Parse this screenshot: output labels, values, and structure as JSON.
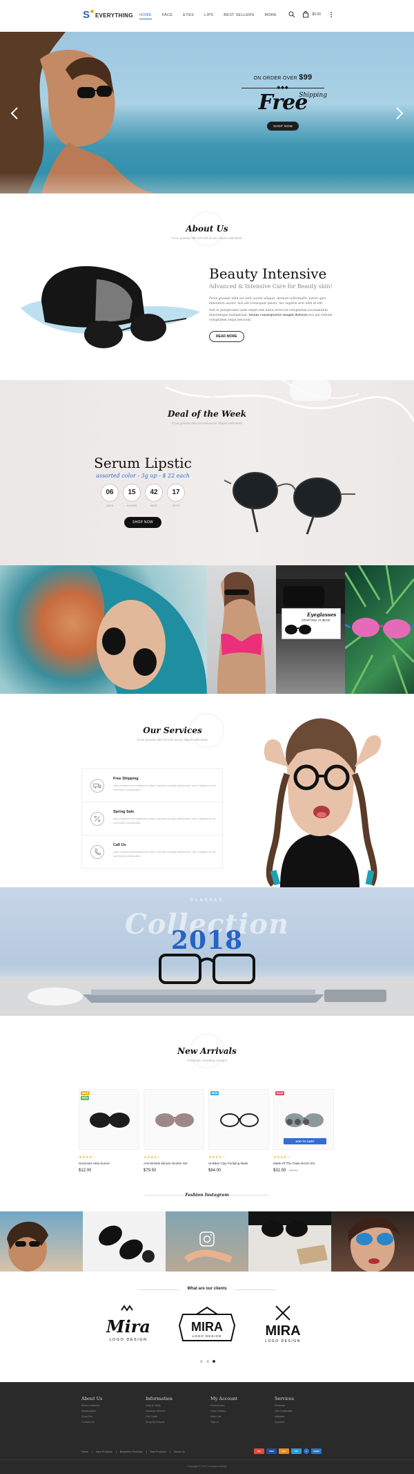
{
  "brand": {
    "logo_letter": "S",
    "name": "EVERYTHING",
    "colors": {
      "accent": "#2f6fd6",
      "dot": "#f2b31b"
    }
  },
  "nav": {
    "items": [
      "HOME",
      "FACE",
      "EYES",
      "LIPS",
      "BEST SELLERS",
      "MORE"
    ],
    "active": "HOME",
    "cart_total": "$0.00",
    "icons": [
      "search-icon",
      "cart-icon",
      "menu-dots-icon"
    ]
  },
  "hero": {
    "order_prefix": "ON ORDER OVER",
    "order_amount": "$99",
    "ornament": "♠♠♠",
    "free": "Free",
    "shipping": "Shipping",
    "button": "SHOP NOW"
  },
  "about": {
    "heading": "About Us",
    "subheading": "Proin gravida nibh vel velit auctor aliquet sollicitudin",
    "title": "Beauty Intensive",
    "tagline": "Advanced & Intensive Care for Beauty skin!",
    "p1": "Proin gravida nibh vel velit auctor aliquet. Aenean sollicitudin, lorem quis bibendum auctor, nisi elit consequat ipsum, nec sagittis sem nibh id elit.",
    "p2_a": "Sed ut perspiciatis unde omnis iste natus error sit voluptatem accusantium doloremque laudantium,",
    "p2_b": "totam consequatur magni dolores",
    "p2_c": "eos qui ratione voluptatem sequi nesciunt.",
    "button": "READ MORE"
  },
  "deal": {
    "heading": "Deal of the Week",
    "subheading": "Proin gravida nibh vel velit auctor aliquet sollicitudin",
    "title": "Serum Lipstic",
    "subtitle": "assorted color - 3g up - $ 22 each",
    "countdown": [
      {
        "value": "06",
        "label": "DAYS"
      },
      {
        "value": "15",
        "label": "HOURS"
      },
      {
        "value": "42",
        "label": "MINS"
      },
      {
        "value": "17",
        "label": "SECS"
      }
    ],
    "button": "SHOP NOW"
  },
  "gallery": {
    "label_title": "Eyeglasses",
    "label_sub": "STARTING AT $9.00"
  },
  "services": {
    "heading": "Our Services",
    "subheading": "Proin gravida nibh vel velit auctor aliquet sollicitudin",
    "items": [
      {
        "icon": "truck-icon",
        "title": "Free Shipping",
        "desc": "Quis nostrum exercitationem ullam corporis suscipit laboriosam, nisi ut aliquid ex ea commodi consequatur."
      },
      {
        "icon": "percent-icon",
        "title": "Spring Sale",
        "desc": "Quis nostrum exercitationem ullam corporis suscipit laboriosam, nisi ut aliquid ex ea commodi consequatur."
      },
      {
        "icon": "phone-icon",
        "title": "Call Us",
        "desc": "Quis nostrum exercitationem ullam corporis suscipit laboriosam, nisi ut aliquid ex ea commodi consequatur."
      }
    ]
  },
  "collection": {
    "glasses": "GLASSES",
    "script": "Collection",
    "year": "2018"
  },
  "arrivals": {
    "heading": "New Arrivals",
    "subheading": "Trendings, sweating, lovages",
    "products": [
      {
        "badge": "SALE",
        "badge_color": "#f2b31b",
        "badge2": "NEW",
        "badge2_color": "#5cb85c",
        "stars": "★★★★☆",
        "name": "Sunsmart Heat Sunvis",
        "price": "$12.00",
        "old": "",
        "frame": "#222"
      },
      {
        "badge": "",
        "badge_color": "",
        "badge2": "",
        "badge2_color": "",
        "stars": "★★★★☆",
        "name": "Anti-Wrinkle Miracle Worker Set",
        "price": "$79.50",
        "old": "",
        "frame": "#8a6a6a"
      },
      {
        "badge": "NEW",
        "badge_color": "#36b3e0",
        "badge2": "",
        "badge2_color": "",
        "stars": "★★★★☆",
        "name": "Unilidan Clay Purifying Mask",
        "price": "$64.00",
        "old": "",
        "frame": "#333"
      },
      {
        "badge": "SALE",
        "badge_color": "#e84b6b",
        "badge2": "",
        "badge2_color": "",
        "stars": "★★★★☆",
        "name": "Made Of The Trade Brush Set",
        "price": "$31.50",
        "old": "$39.00",
        "frame": "#555",
        "cart": "ADD TO CART"
      }
    ]
  },
  "instagram": {
    "title": "Fashion Instagram"
  },
  "clients": {
    "title": "What are our clients",
    "logos": [
      {
        "name": "Mira",
        "tag": "LOGO DESIGN"
      },
      {
        "name": "MIRA",
        "tag": "LOGO DESIGN"
      },
      {
        "name": "MIRA",
        "tag": "LOGO DESIGN"
      }
    ]
  },
  "footer": {
    "columns": [
      {
        "title": "About Us",
        "links": [
          "Store Locations",
          "Wholesalers",
          "Shop Site",
          "Contact Us"
        ]
      },
      {
        "title": "Information",
        "links": [
          "Help & FAQs",
          "Advance Search",
          "Gift Cards",
          "Shop By Brands"
        ]
      },
      {
        "title": "My Account",
        "links": [
          "Preferences",
          "Order History",
          "Wish List",
          "Sign-in"
        ]
      },
      {
        "title": "Services",
        "links": [
          "Rewards",
          "Gift Certificates",
          "Affiliates",
          "Specials"
        ]
      }
    ],
    "bottom_links": [
      "Home",
      "New Products",
      "Bestseller Products",
      "Sale Products",
      "About Us"
    ],
    "payments": [
      {
        "label": "MC",
        "color": "#e54b3c"
      },
      {
        "label": "VISA",
        "color": "#1f4fa3"
      },
      {
        "label": "DSC",
        "color": "#e6881f"
      },
      {
        "label": "PP",
        "color": "#2f9bd8"
      },
      {
        "label": "●",
        "color": "#2f6fd6"
      },
      {
        "label": "AMEX",
        "color": "#2677c4"
      }
    ],
    "copyright": "Copyright © 2017 codespot design"
  }
}
